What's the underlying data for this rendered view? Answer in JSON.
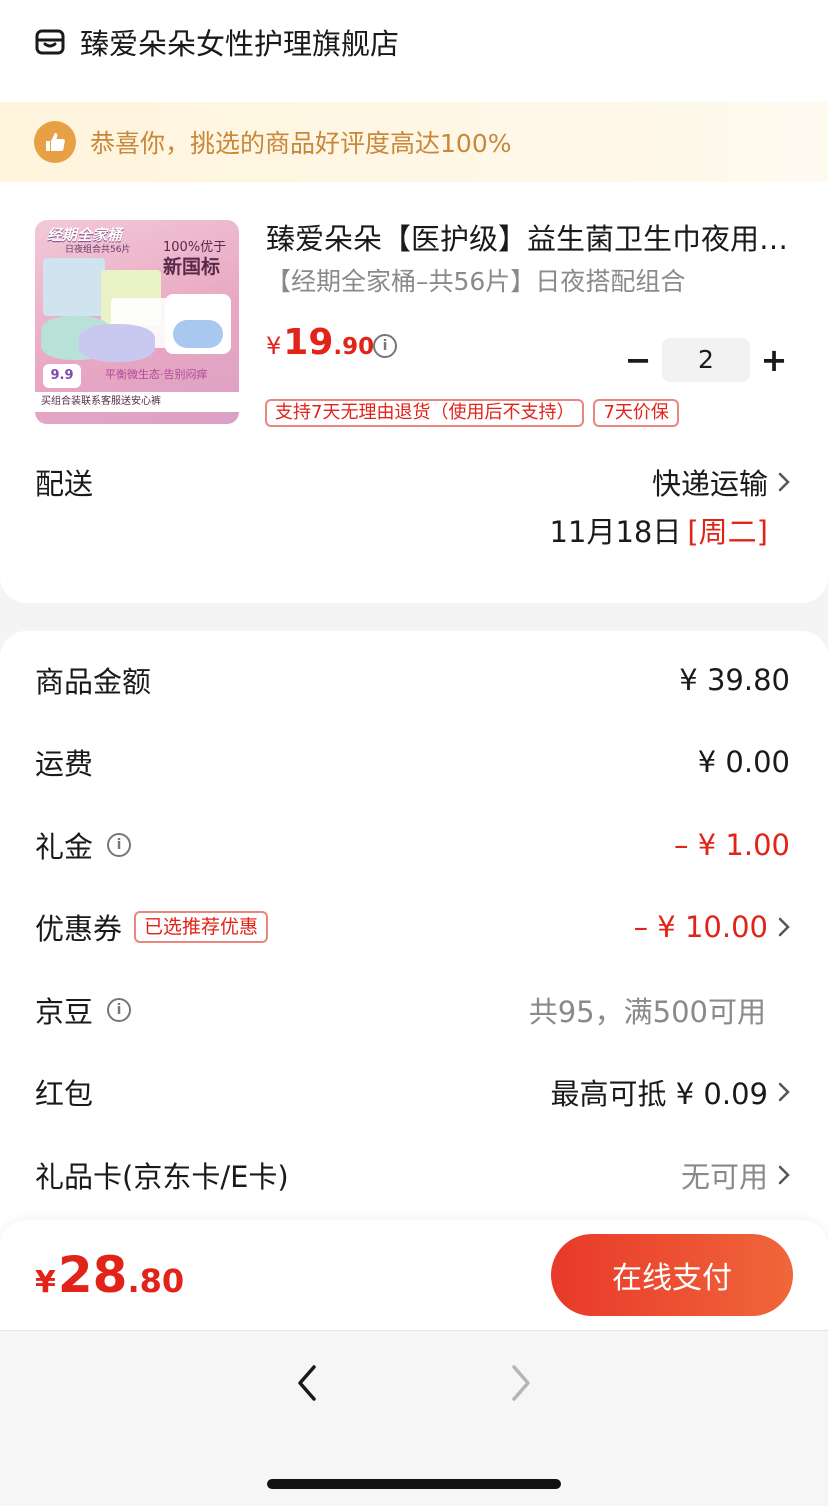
{
  "store": {
    "name": "臻爱朵朵女性护理旗舰店",
    "icon": "store-icon"
  },
  "banner": {
    "text": "恭喜你，挑选的商品好评度高达100%",
    "icon": "thumbs-up-icon"
  },
  "product": {
    "image_texts": {
      "title": "经期全家桶",
      "subtitle": "日夜组合共56片",
      "claim_line1": "100%优于",
      "claim_line2": "新国标",
      "price_badge": "9.9",
      "slogan": "平衡微生态·告别闷痒",
      "strip": "买组合装联系客服送安心裤"
    },
    "title": "臻爱朵朵【医护级】益生菌卫生巾夜用超薄棉柔透气姨妈巾",
    "spec": "【经期全家桶–共56片】日夜搭配组合",
    "price": {
      "symbol": "¥",
      "integer": "19",
      "decimal": ".90"
    },
    "quantity": "2",
    "minus": "−",
    "plus": "+",
    "tags": [
      "支持7天无理由退货（使用后不支持）",
      "7天价保"
    ]
  },
  "shipping": {
    "label": "配送",
    "method": "快递运输",
    "date": "11月18日",
    "weekday": "[周二]"
  },
  "price_rows": [
    {
      "label": "商品金额",
      "value": "¥ 39.80"
    },
    {
      "label": "运费",
      "value": "¥ 0.00"
    },
    {
      "label": "礼金",
      "value": "– ¥ 1.00"
    },
    {
      "label": "优惠券",
      "tag": "已选推荐优惠",
      "value": "– ¥ 10.00"
    },
    {
      "label": "京豆",
      "value": "共95，满500可用"
    },
    {
      "label": "红包",
      "value": "最高可抵 ¥ 0.09"
    },
    {
      "label": "礼品卡(京东卡/E卡)",
      "value": "无可用"
    }
  ],
  "footer": {
    "total": {
      "symbol": "¥",
      "integer": "28",
      "decimal": ".80"
    },
    "pay_button": "在线支付"
  },
  "colors": {
    "accent": "#e2231a",
    "banner_text": "#c8873a",
    "pay_gradient_start": "#e8392a",
    "pay_gradient_end": "#f0663a"
  }
}
